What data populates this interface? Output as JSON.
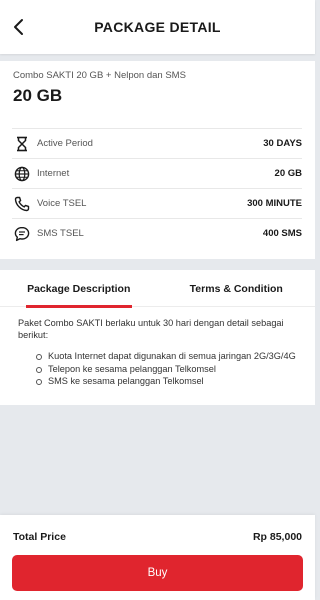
{
  "header": {
    "title": "PACKAGE DETAIL",
    "back_icon": "chevron-left-icon"
  },
  "package": {
    "name": "Combo SAKTI 20 GB + Nelpon dan SMS",
    "quota": "20 GB",
    "details": [
      {
        "icon": "hourglass-icon",
        "label": "Active Period",
        "value": "30 DAYS"
      },
      {
        "icon": "globe-icon",
        "label": "Internet",
        "value": "20 GB"
      },
      {
        "icon": "phone-icon",
        "label": "Voice TSEL",
        "value": "300 MINUTE"
      },
      {
        "icon": "message-icon",
        "label": "SMS TSEL",
        "value": "400 SMS"
      }
    ]
  },
  "tabs": [
    {
      "label": "Package Description",
      "active": true
    },
    {
      "label": "Terms & Condition",
      "active": false
    }
  ],
  "description": {
    "intro": "Paket Combo SAKTI berlaku untuk 30 hari dengan detail sebagai berikut:",
    "items": [
      "Kuota Internet dapat digunakan di semua jaringan 2G/3G/4G",
      "Telepon ke sesama pelanggan Telkomsel",
      "SMS ke sesama pelanggan Telkomsel"
    ]
  },
  "footer": {
    "total_label": "Total Price",
    "total_value": "Rp 85,000",
    "buy_label": "Buy"
  },
  "colors": {
    "accent": "#e0252e",
    "background": "#e6e9ed"
  }
}
